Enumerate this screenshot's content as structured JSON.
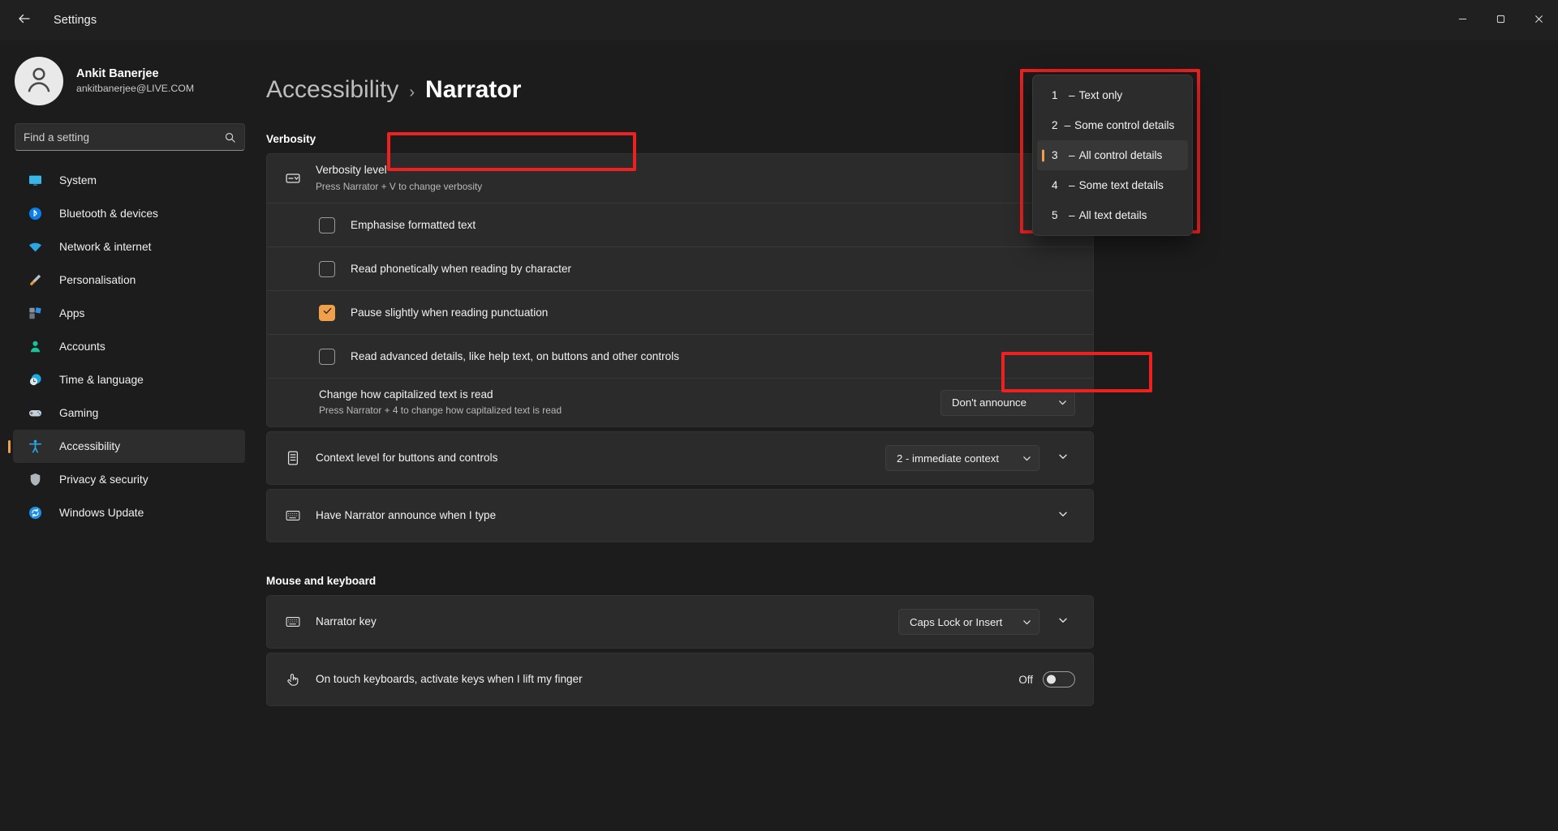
{
  "titlebar": {
    "back_icon": "arrow-left-icon",
    "app_title": "Settings",
    "minimize_icon": "minimize-icon",
    "maximize_icon": "maximize-icon",
    "close_icon": "close-icon"
  },
  "sidebar": {
    "profile": {
      "avatar_icon": "user-avatar-icon",
      "name": "Ankit Banerjee",
      "email": "ankitbanerjee@LIVE.COM"
    },
    "search": {
      "placeholder": "Find a setting",
      "value": "",
      "icon": "search-icon"
    },
    "items": [
      {
        "label": "System",
        "icon": "monitor-icon",
        "selected": false
      },
      {
        "label": "Bluetooth & devices",
        "icon": "bluetooth-icon",
        "selected": false
      },
      {
        "label": "Network & internet",
        "icon": "wifi-icon",
        "selected": false
      },
      {
        "label": "Personalisation",
        "icon": "paintbrush-icon",
        "selected": false
      },
      {
        "label": "Apps",
        "icon": "apps-icon",
        "selected": false
      },
      {
        "label": "Accounts",
        "icon": "person-icon",
        "selected": false
      },
      {
        "label": "Time & language",
        "icon": "clock-globe-icon",
        "selected": false
      },
      {
        "label": "Gaming",
        "icon": "gamepad-icon",
        "selected": false
      },
      {
        "label": "Accessibility",
        "icon": "accessibility-icon",
        "selected": true
      },
      {
        "label": "Privacy & security",
        "icon": "shield-icon",
        "selected": false
      },
      {
        "label": "Windows Update",
        "icon": "update-icon",
        "selected": false
      }
    ]
  },
  "breadcrumb": {
    "parent": "Accessibility",
    "separator": "›",
    "current": "Narrator"
  },
  "sections": [
    {
      "heading": "Verbosity"
    },
    {
      "heading": "Mouse and keyboard"
    }
  ],
  "verbosity": {
    "level_row": {
      "icon": "combobox-icon",
      "title": "Verbosity level",
      "subtitle": "Press Narrator + V to change verbosity"
    },
    "checkboxes": [
      {
        "label": "Emphasise formatted text",
        "checked": false
      },
      {
        "label": "Read phonetically when reading by character",
        "checked": false
      },
      {
        "label": "Pause slightly when reading punctuation",
        "checked": true
      },
      {
        "label": "Read advanced details, like help text, on buttons and other controls",
        "checked": false
      }
    ],
    "capitalized_row": {
      "title": "Change how capitalized text is read",
      "subtitle": "Press Narrator + 4 to change how capitalized text is read",
      "dropdown_value": "Don't announce",
      "chevron_icon": "chevron-down-icon"
    },
    "context_row": {
      "icon": "list-icon",
      "title": "Context level for buttons and controls",
      "dropdown_value": "2 - immediate context",
      "chevron_icon": "chevron-down-icon",
      "expander_icon": "chevron-down-icon"
    },
    "announce_type_row": {
      "icon": "keyboard-icon",
      "title": "Have Narrator announce when I type",
      "expander_icon": "chevron-down-icon"
    }
  },
  "mouse_keyboard": {
    "narrator_key_row": {
      "icon": "keyboard-icon",
      "title": "Narrator key",
      "dropdown_value": "Caps Lock or Insert",
      "chevron_icon": "chevron-down-icon",
      "expander_icon": "chevron-down-icon"
    },
    "touch_keyboard_row": {
      "icon": "touch-icon",
      "title": "On touch keyboards, activate keys when I lift my finger",
      "toggle_label": "Off",
      "toggle_on": false
    }
  },
  "verbosity_flyout": {
    "items": [
      {
        "num": "1",
        "dash": "–",
        "text": "Text only",
        "selected": false
      },
      {
        "num": "2",
        "dash": "–",
        "text": "Some control details",
        "selected": false
      },
      {
        "num": "3",
        "dash": "–",
        "text": "All control details",
        "selected": true
      },
      {
        "num": "4",
        "dash": "–",
        "text": "Some text details",
        "selected": false
      },
      {
        "num": "5",
        "dash": "–",
        "text": "All text details",
        "selected": false
      }
    ]
  },
  "colors": {
    "accent_orange": "#f0a04b",
    "annotation_red": "#ef2020",
    "window_bg": "#1c1c1c",
    "card_bg": "#2b2b2b"
  }
}
